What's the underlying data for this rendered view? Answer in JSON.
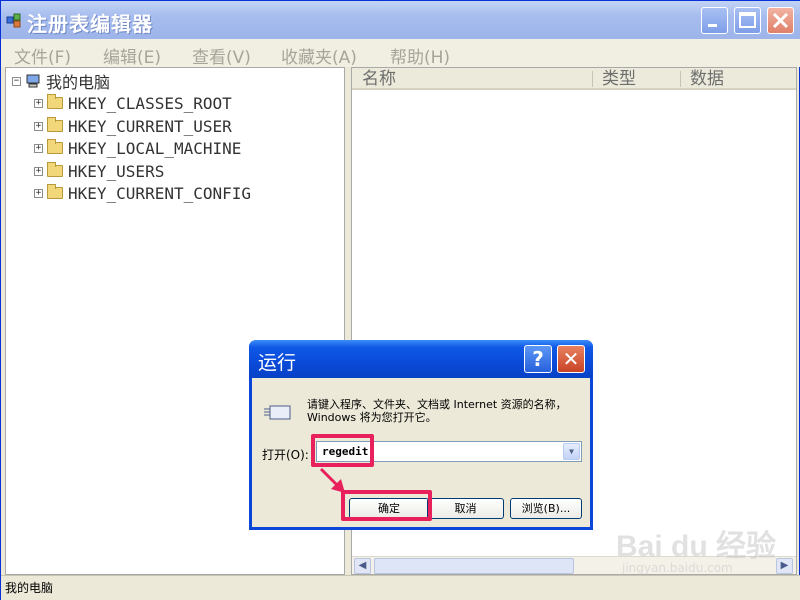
{
  "window": {
    "title": "注册表编辑器"
  },
  "menu": [
    "文件(F)",
    "编辑(E)",
    "查看(V)",
    "收藏夹(A)",
    "帮助(H)"
  ],
  "tree": {
    "root": "我的电脑",
    "items": [
      "HKEY_CLASSES_ROOT",
      "HKEY_CURRENT_USER",
      "HKEY_LOCAL_MACHINE",
      "HKEY_USERS",
      "HKEY_CURRENT_CONFIG"
    ]
  },
  "list": {
    "columns": [
      "名称",
      "类型",
      "数据"
    ]
  },
  "status": "我的电脑",
  "run_dialog": {
    "title": "运行",
    "description": "请键入程序、文件夹、文档或 Internet 资源的名称，Windows 将为您打开它。",
    "open_label": "打开(O):",
    "open_value": "regedit",
    "ok_label": "确定",
    "cancel_label": "取消",
    "browse_label": "浏览(B)..."
  },
  "watermark": {
    "text": "Bai du 经验",
    "sub": "jingyan.baidu.com"
  },
  "colors": {
    "highlight": "#e8205c",
    "xp_blue": "#0a46d8"
  }
}
